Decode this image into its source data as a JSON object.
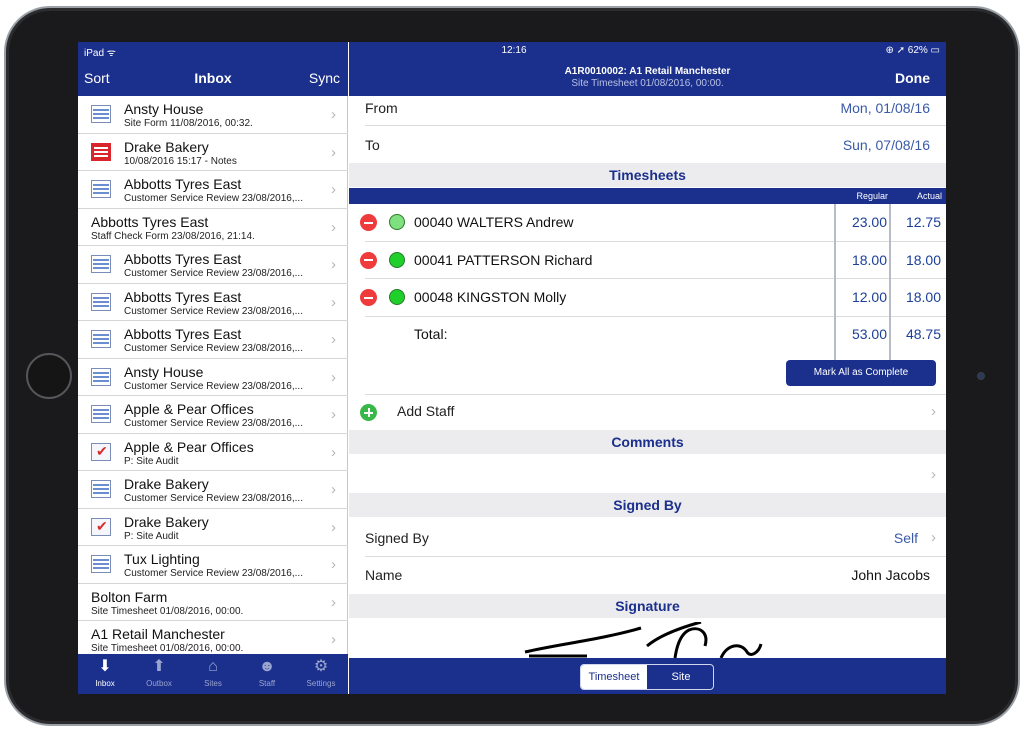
{
  "left": {
    "status": "iPad ᯤ",
    "sort_label": "Sort",
    "title": "Inbox",
    "sync_label": "Sync",
    "items": [
      {
        "title": "Ansty House",
        "subtitle": "Site Form 11/08/2016, 00:32.",
        "icon": "form"
      },
      {
        "title": "Drake Bakery",
        "subtitle": "10/08/2016 15:17 - Notes",
        "icon": "notes"
      },
      {
        "title": "Abbotts Tyres East",
        "subtitle": "Customer Service Review 23/08/2016,...",
        "icon": "form"
      },
      {
        "title": "Abbotts Tyres East",
        "subtitle": "Staff Check Form 23/08/2016, 21:14.",
        "icon": "none"
      },
      {
        "title": "Abbotts Tyres East",
        "subtitle": "Customer Service Review 23/08/2016,...",
        "icon": "form"
      },
      {
        "title": "Abbotts Tyres East",
        "subtitle": "Customer Service Review 23/08/2016,...",
        "icon": "form"
      },
      {
        "title": "Abbotts Tyres East",
        "subtitle": "Customer Service Review 23/08/2016,...",
        "icon": "form"
      },
      {
        "title": "Ansty House",
        "subtitle": "Customer Service Review 23/08/2016,...",
        "icon": "form"
      },
      {
        "title": "Apple & Pear Offices",
        "subtitle": "Customer Service Review 23/08/2016,...",
        "icon": "form"
      },
      {
        "title": "Apple & Pear Offices",
        "subtitle": "P: Site Audit",
        "icon": "audit"
      },
      {
        "title": "Drake Bakery",
        "subtitle": "Customer Service Review 23/08/2016,...",
        "icon": "form"
      },
      {
        "title": "Drake Bakery",
        "subtitle": "P: Site Audit",
        "icon": "audit"
      },
      {
        "title": "Tux Lighting",
        "subtitle": "Customer Service Review 23/08/2016,...",
        "icon": "form"
      },
      {
        "title": "Bolton Farm",
        "subtitle": "Site Timesheet 01/08/2016, 00:00.",
        "icon": "none"
      },
      {
        "title": "A1 Retail Manchester",
        "subtitle": "Site Timesheet 01/08/2016, 00:00.",
        "icon": "none"
      }
    ],
    "tabs": [
      {
        "label": "Inbox",
        "icon": "inbox-icon",
        "glyph": "⬇",
        "active": true
      },
      {
        "label": "Outbox",
        "icon": "outbox-icon",
        "glyph": "⬆",
        "active": false
      },
      {
        "label": "Sites",
        "icon": "sites-icon",
        "glyph": "⌂",
        "active": false
      },
      {
        "label": "Staff",
        "icon": "staff-icon",
        "glyph": "☻",
        "active": false
      },
      {
        "label": "Settings",
        "icon": "settings-icon",
        "glyph": "⚙",
        "active": false
      }
    ]
  },
  "right": {
    "time": "12:16",
    "status": "⊕ ➚ 62% ▭",
    "title": "A1R0010002: A1 Retail Manchester",
    "subtitle": "Site Timesheet 01/08/2016, 00:00.",
    "done_label": "Done",
    "from_label": "From",
    "from_value": "Mon, 01/08/16",
    "to_label": "To",
    "to_value": "Sun, 07/08/16",
    "timesheets_header": "Timesheets",
    "col_regular": "Regular",
    "col_actual": "Actual",
    "rows": [
      {
        "name": "00040 WALTERS Andrew",
        "regular": "23.00",
        "actual": "12.75",
        "status_color": "#7fe07f"
      },
      {
        "name": "00041 PATTERSON Richard",
        "regular": "18.00",
        "actual": "18.00",
        "status_color": "#1fcf2a"
      },
      {
        "name": "00048 KINGSTON Molly",
        "regular": "12.00",
        "actual": "18.00",
        "status_color": "#1fcf2a"
      }
    ],
    "total_label": "Total:",
    "total_regular": "53.00",
    "total_actual": "48.75",
    "mark_complete_label": "Mark All as Complete",
    "add_staff_label": "Add Staff",
    "comments_header": "Comments",
    "signed_by_header": "Signed By",
    "signed_by_label": "Signed By",
    "signed_by_value": "Self",
    "name_label": "Name",
    "name_value": "John Jacobs",
    "signature_header": "Signature",
    "segment_timesheet": "Timesheet",
    "segment_site": "Site"
  },
  "colors": {
    "brand_blue": "#1b2f8c",
    "link_blue": "#3a5aa8",
    "remove_red": "#ef3b3b",
    "add_green": "#39b84a"
  }
}
